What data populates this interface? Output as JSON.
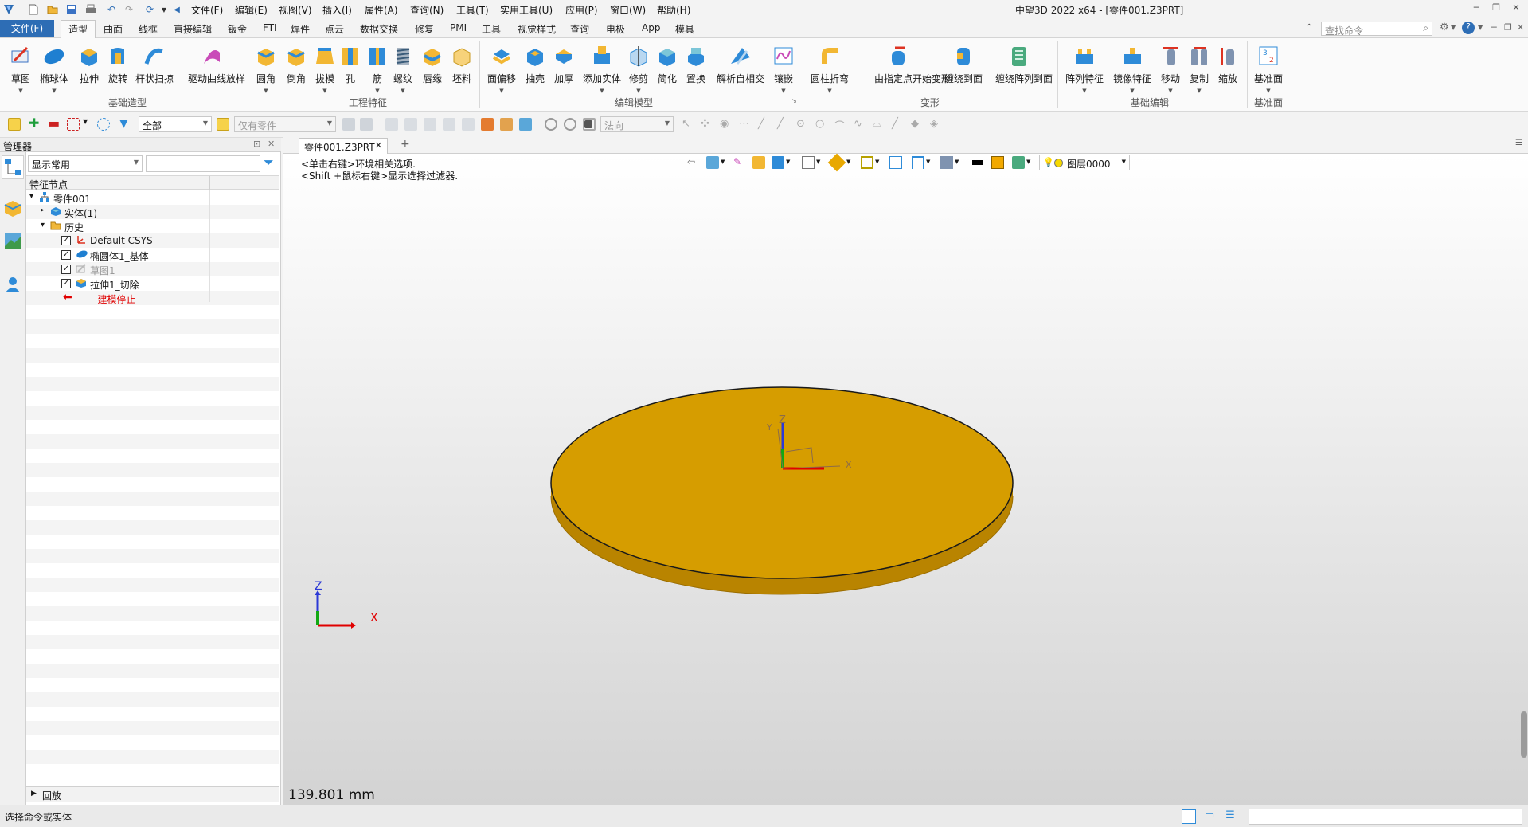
{
  "app": {
    "title": "中望3D 2022 x64 - [零件001.Z3PRT]",
    "menus": [
      "文件(F)",
      "编辑(E)",
      "视图(V)",
      "插入(I)",
      "属性(A)",
      "查询(N)",
      "工具(T)",
      "实用工具(U)",
      "应用(P)",
      "窗口(W)",
      "帮助(H)"
    ],
    "search_placeholder": "查找命令"
  },
  "ribbon_tabs": [
    "文件(F)",
    "造型",
    "曲面",
    "线框",
    "直接编辑",
    "钣金",
    "FTI",
    "焊件",
    "点云",
    "数据交换",
    "修复",
    "PMI",
    "工具",
    "视觉样式",
    "查询",
    "电极",
    "App",
    "模具"
  ],
  "ribbon_groups": [
    {
      "label": "基础造型",
      "buttons": [
        "草图",
        "椭球体",
        "拉伸",
        "旋转",
        "杆状扫掠",
        "驱动曲线放样"
      ]
    },
    {
      "label": "工程特征",
      "buttons": [
        "圆角",
        "倒角",
        "拔模",
        "孔",
        "筋",
        "螺纹",
        "唇缘",
        "坯料"
      ]
    },
    {
      "label": "编辑模型",
      "buttons": [
        "面偏移",
        "抽壳",
        "加厚",
        "添加实体",
        "修剪",
        "简化",
        "置换",
        "解析自相交",
        "镶嵌"
      ]
    },
    {
      "label": "变形",
      "buttons": [
        "圆柱折弯",
        "由指定点开始变形",
        "缠绕到面",
        "缠绕阵列到面"
      ]
    },
    {
      "label": "基础编辑",
      "buttons": [
        "阵列特征",
        "镜像特征",
        "移动",
        "复制",
        "缩放"
      ]
    },
    {
      "label": "基准面",
      "buttons": [
        "基准面"
      ]
    }
  ],
  "toolbar": {
    "filter_all": "全部",
    "only_parts": "仅有零件",
    "normal_dir": "法向"
  },
  "manager": {
    "title": "管理器",
    "filter_combo": "显示常用",
    "tree_header": "特征节点",
    "tree": [
      {
        "label": "零件001"
      },
      {
        "label": "实体(1)"
      },
      {
        "label": "历史"
      },
      {
        "label": "Default CSYS",
        "checked": true
      },
      {
        "label": "椭圆体1_基体",
        "checked": true
      },
      {
        "label": "草图1",
        "checked": true
      },
      {
        "label": "拉伸1_切除",
        "checked": true
      },
      {
        "label": "----- 建模停止 -----"
      }
    ],
    "rollback_label": "回放"
  },
  "document": {
    "tab_label": "零件001.Z3PRT",
    "hint_line1": "<单击右键>环境相关选项.",
    "hint_line2": "<Shift +鼠标右键>显示选择过滤器.",
    "layer_label": "图层0000",
    "measure_readout": "139.801 mm",
    "axis_x": "X",
    "axis_y": "Y",
    "axis_z": "Z"
  },
  "status": {
    "prompt": "选择命令或实体"
  },
  "colors": {
    "accent": "#2d6db5",
    "model_fill": "#d69d00",
    "model_edge": "#1a1a1a",
    "stop_text": "#e00000"
  }
}
